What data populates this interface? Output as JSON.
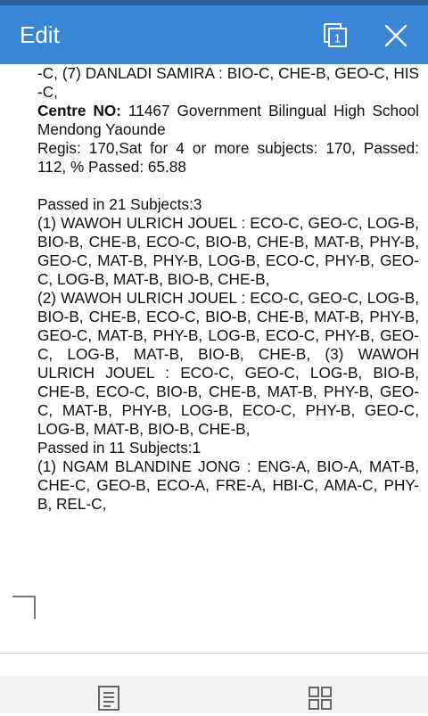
{
  "appbar": {
    "title": "Edit",
    "page_badge": "1",
    "icons": {
      "pages": "pages-icon",
      "close": "close-icon"
    }
  },
  "document": {
    "line1": "-C, (7) DANLADI SAMIRA : BIO-C, CHE-B, GEO-C, HIS -C,",
    "centre_label": "Centre NO:",
    "centre_text": " 11467 Government Bilingual High School Mendong Yaounde",
    "regis": "Regis: 170,Sat for 4 or more subjects: 170, Passed: 112, % Passed: 65.88",
    "passed21_header": "Passed in 21 Subjects:3",
    "entry1": "(1) WAWOH ULRICH JOUEL : ECO-C, GEO-C, LOG-B, BIO-B, CHE-B, ECO-C, BIO-B, CHE-B, MAT-B, PHY-B, GEO-C, MAT-B, PHY-B, LOG-B, ECO-C, PHY-B, GEO-C, LOG-B, MAT-B, BIO-B, CHE-B,",
    "entry2": "(2) WAWOH ULRICH JOUEL : ECO-C, GEO-C, LOG-B, BIO-B, CHE-B, ECO-C, BIO-B, CHE-B, MAT-B, PHY-B, GEO-C, MAT-B, PHY-B, LOG-B, ECO-C, PHY-B, GEO-C, LOG-B, MAT-B, BIO-B, CHE-B, (3) WAWOH ULRICH JOUEL : ECO-C, GEO-C, LOG-B, BIO-B, CHE-B, ECO-C, BIO-B, CHE-B, MAT-B, PHY-B, GEO-C, MAT-B, PHY-B, LOG-B, ECO-C, PHY-B, GEO-C, LOG-B, MAT-B, BIO-B, CHE-B,",
    "passed11_header": "Passed in 11 Subjects:1",
    "entry3": "(1) NGAM BLANDINE JONG : ENG-A, BIO-A, MAT-B, CHE-C, GEO-B, ECO-A, FRE-A, HBI-C, AMA-C, PHY-B, REL-C,"
  },
  "bottombar": {
    "icons": {
      "outline": "outline-icon",
      "grid": "grid-icon"
    }
  },
  "colors": {
    "appbar": "#3a86d6",
    "statusbar": "#2f5e9e",
    "bottombar": "#f2f2f2"
  }
}
